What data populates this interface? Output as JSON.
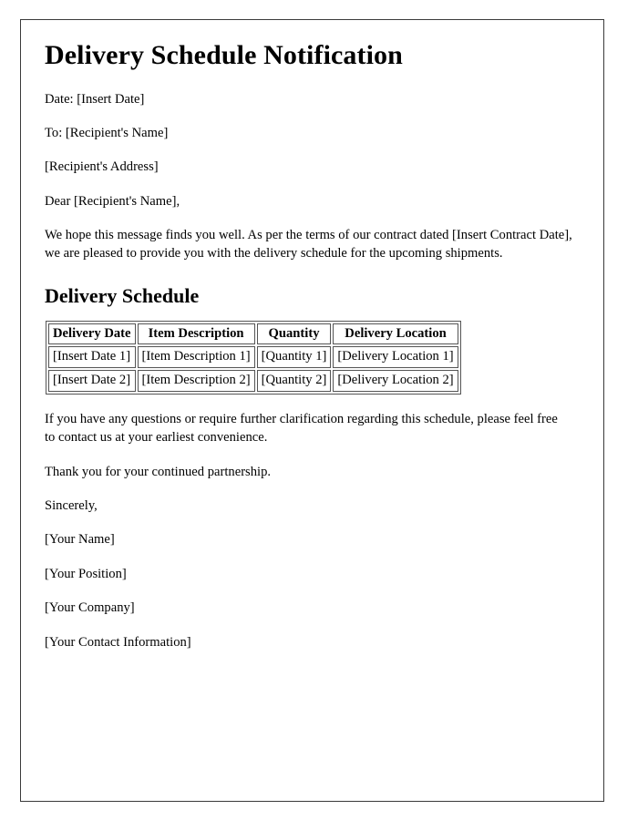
{
  "document": {
    "title": "Delivery Schedule Notification",
    "header_lines": [
      "Date: [Insert Date]",
      "To: [Recipient's Name]",
      "[Recipient's Address]"
    ],
    "salutation": "Dear [Recipient's Name],",
    "intro_paragraph": "We hope this message finds you well. As per the terms of our contract dated [Insert Contract Date], we are pleased to provide you with the delivery schedule for the upcoming shipments.",
    "section_heading": "Delivery Schedule",
    "table": {
      "headers": [
        "Delivery Date",
        "Item Description",
        "Quantity",
        "Delivery Location"
      ],
      "rows": [
        [
          "[Insert Date 1]",
          "[Item Description 1]",
          "[Quantity 1]",
          "[Delivery Location 1]"
        ],
        [
          "[Insert Date 2]",
          "[Item Description 2]",
          "[Quantity 2]",
          "[Delivery Location 2]"
        ]
      ]
    },
    "closing_paragraph": "If you have any questions or require further clarification regarding this schedule, please feel free to contact us at your earliest convenience.",
    "thanks_paragraph": "Thank you for your continued partnership.",
    "signoff": "Sincerely,",
    "signature_lines": [
      "[Your Name]",
      "[Your Position]",
      "[Your Company]",
      "[Your Contact Information]"
    ]
  },
  "colors": {
    "page_border": "#3a3a3a",
    "table_border": "#555555",
    "text": "#000000",
    "background": "#ffffff"
  }
}
